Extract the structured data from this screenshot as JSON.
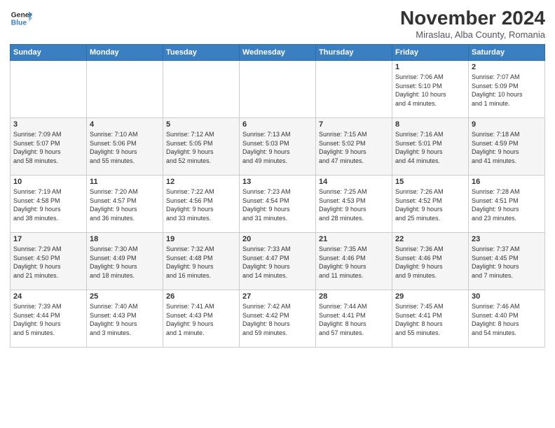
{
  "header": {
    "logo_line1": "General",
    "logo_line2": "Blue",
    "month_title": "November 2024",
    "subtitle": "Miraslau, Alba County, Romania"
  },
  "weekdays": [
    "Sunday",
    "Monday",
    "Tuesday",
    "Wednesday",
    "Thursday",
    "Friday",
    "Saturday"
  ],
  "weeks": [
    [
      {
        "day": "",
        "info": ""
      },
      {
        "day": "",
        "info": ""
      },
      {
        "day": "",
        "info": ""
      },
      {
        "day": "",
        "info": ""
      },
      {
        "day": "",
        "info": ""
      },
      {
        "day": "1",
        "info": "Sunrise: 7:06 AM\nSunset: 5:10 PM\nDaylight: 10 hours\nand 4 minutes."
      },
      {
        "day": "2",
        "info": "Sunrise: 7:07 AM\nSunset: 5:09 PM\nDaylight: 10 hours\nand 1 minute."
      }
    ],
    [
      {
        "day": "3",
        "info": "Sunrise: 7:09 AM\nSunset: 5:07 PM\nDaylight: 9 hours\nand 58 minutes."
      },
      {
        "day": "4",
        "info": "Sunrise: 7:10 AM\nSunset: 5:06 PM\nDaylight: 9 hours\nand 55 minutes."
      },
      {
        "day": "5",
        "info": "Sunrise: 7:12 AM\nSunset: 5:05 PM\nDaylight: 9 hours\nand 52 minutes."
      },
      {
        "day": "6",
        "info": "Sunrise: 7:13 AM\nSunset: 5:03 PM\nDaylight: 9 hours\nand 49 minutes."
      },
      {
        "day": "7",
        "info": "Sunrise: 7:15 AM\nSunset: 5:02 PM\nDaylight: 9 hours\nand 47 minutes."
      },
      {
        "day": "8",
        "info": "Sunrise: 7:16 AM\nSunset: 5:01 PM\nDaylight: 9 hours\nand 44 minutes."
      },
      {
        "day": "9",
        "info": "Sunrise: 7:18 AM\nSunset: 4:59 PM\nDaylight: 9 hours\nand 41 minutes."
      }
    ],
    [
      {
        "day": "10",
        "info": "Sunrise: 7:19 AM\nSunset: 4:58 PM\nDaylight: 9 hours\nand 38 minutes."
      },
      {
        "day": "11",
        "info": "Sunrise: 7:20 AM\nSunset: 4:57 PM\nDaylight: 9 hours\nand 36 minutes."
      },
      {
        "day": "12",
        "info": "Sunrise: 7:22 AM\nSunset: 4:56 PM\nDaylight: 9 hours\nand 33 minutes."
      },
      {
        "day": "13",
        "info": "Sunrise: 7:23 AM\nSunset: 4:54 PM\nDaylight: 9 hours\nand 31 minutes."
      },
      {
        "day": "14",
        "info": "Sunrise: 7:25 AM\nSunset: 4:53 PM\nDaylight: 9 hours\nand 28 minutes."
      },
      {
        "day": "15",
        "info": "Sunrise: 7:26 AM\nSunset: 4:52 PM\nDaylight: 9 hours\nand 25 minutes."
      },
      {
        "day": "16",
        "info": "Sunrise: 7:28 AM\nSunset: 4:51 PM\nDaylight: 9 hours\nand 23 minutes."
      }
    ],
    [
      {
        "day": "17",
        "info": "Sunrise: 7:29 AM\nSunset: 4:50 PM\nDaylight: 9 hours\nand 21 minutes."
      },
      {
        "day": "18",
        "info": "Sunrise: 7:30 AM\nSunset: 4:49 PM\nDaylight: 9 hours\nand 18 minutes."
      },
      {
        "day": "19",
        "info": "Sunrise: 7:32 AM\nSunset: 4:48 PM\nDaylight: 9 hours\nand 16 minutes."
      },
      {
        "day": "20",
        "info": "Sunrise: 7:33 AM\nSunset: 4:47 PM\nDaylight: 9 hours\nand 14 minutes."
      },
      {
        "day": "21",
        "info": "Sunrise: 7:35 AM\nSunset: 4:46 PM\nDaylight: 9 hours\nand 11 minutes."
      },
      {
        "day": "22",
        "info": "Sunrise: 7:36 AM\nSunset: 4:46 PM\nDaylight: 9 hours\nand 9 minutes."
      },
      {
        "day": "23",
        "info": "Sunrise: 7:37 AM\nSunset: 4:45 PM\nDaylight: 9 hours\nand 7 minutes."
      }
    ],
    [
      {
        "day": "24",
        "info": "Sunrise: 7:39 AM\nSunset: 4:44 PM\nDaylight: 9 hours\nand 5 minutes."
      },
      {
        "day": "25",
        "info": "Sunrise: 7:40 AM\nSunset: 4:43 PM\nDaylight: 9 hours\nand 3 minutes."
      },
      {
        "day": "26",
        "info": "Sunrise: 7:41 AM\nSunset: 4:43 PM\nDaylight: 9 hours\nand 1 minute."
      },
      {
        "day": "27",
        "info": "Sunrise: 7:42 AM\nSunset: 4:42 PM\nDaylight: 8 hours\nand 59 minutes."
      },
      {
        "day": "28",
        "info": "Sunrise: 7:44 AM\nSunset: 4:41 PM\nDaylight: 8 hours\nand 57 minutes."
      },
      {
        "day": "29",
        "info": "Sunrise: 7:45 AM\nSunset: 4:41 PM\nDaylight: 8 hours\nand 55 minutes."
      },
      {
        "day": "30",
        "info": "Sunrise: 7:46 AM\nSunset: 4:40 PM\nDaylight: 8 hours\nand 54 minutes."
      }
    ]
  ]
}
